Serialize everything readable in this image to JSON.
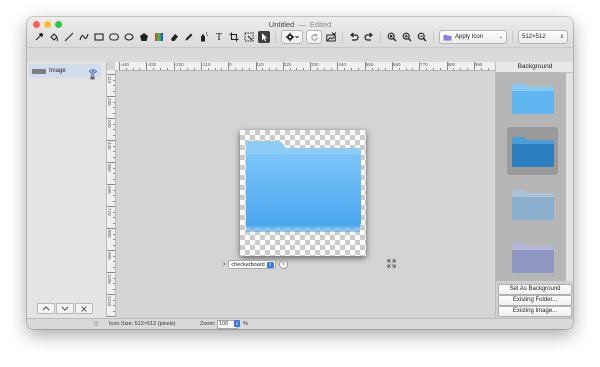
{
  "window": {
    "title": "Untitled",
    "edited_label": "Edited",
    "title_separator": "—"
  },
  "traffic_lights": {
    "close_color": "#fe5f57",
    "minimize_color": "#febb2e",
    "zoom_color": "#28c840"
  },
  "toolbar": {
    "tools": [
      {
        "name": "eyedropper",
        "icon": "eyedropper-icon"
      },
      {
        "name": "fill-bucket",
        "icon": "paint-bucket-icon"
      },
      {
        "name": "line",
        "icon": "line-icon"
      },
      {
        "name": "curve",
        "icon": "curve-icon"
      },
      {
        "name": "rectangle",
        "icon": "rectangle-icon"
      },
      {
        "name": "rounded-rectangle",
        "icon": "rounded-rectangle-icon"
      },
      {
        "name": "oval",
        "icon": "oval-icon"
      },
      {
        "name": "polygon",
        "icon": "polygon-icon"
      },
      {
        "name": "gradient",
        "icon": "gradient-icon"
      },
      {
        "name": "eraser",
        "icon": "eraser-icon"
      },
      {
        "name": "pencil",
        "icon": "pencil-icon"
      },
      {
        "name": "spray",
        "icon": "spray-can-icon"
      },
      {
        "name": "text",
        "icon": "text-icon"
      },
      {
        "name": "crop",
        "icon": "crop-icon"
      },
      {
        "name": "magic-select",
        "icon": "magic-select-icon"
      },
      {
        "name": "pointer",
        "icon": "arrow-pointer-icon"
      }
    ],
    "text_tool_glyph": "T",
    "apply_icon_label": "Apply Icon",
    "size_value": "512×512",
    "accent_color": "#3a7ae0"
  },
  "layers": {
    "items": [
      {
        "label": "Image"
      }
    ]
  },
  "rulers": {
    "horizontal": [
      "-440",
      "-330",
      "-220",
      "-110",
      "0",
      "110",
      "220",
      "330",
      "440",
      "550",
      "660",
      "770",
      "880",
      "990"
    ],
    "vertical": [
      "110",
      "220",
      "330",
      "440",
      "550",
      "660",
      "770",
      "880",
      "990",
      "1100",
      "1210"
    ]
  },
  "background_control": {
    "value": "checkerboard",
    "help": "?"
  },
  "right_panel": {
    "heading": "Background",
    "thumbnails": [
      "light-blue-folder-icon",
      "blue-folder-icon",
      "graphite-folder-icon",
      "purple-folder-icon"
    ],
    "set_as_background": "Set As Background",
    "existing_folder": "Existing Folder...",
    "existing_image": "Existing Image..."
  },
  "status": {
    "icon_size": "Icon Size: 512×512 (pixels)",
    "zoom_label": "Zoom:",
    "zoom_value": "100",
    "zoom_unit": "%"
  }
}
